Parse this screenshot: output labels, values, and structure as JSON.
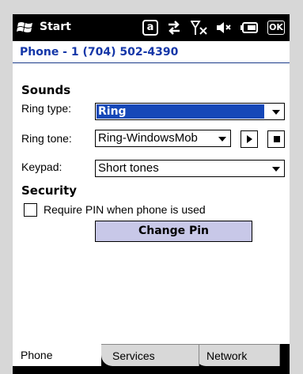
{
  "titlebar": {
    "start_label": "Start",
    "tray_icons": [
      "at-sign-icon",
      "sync-icon",
      "signal-off-icon",
      "speaker-muted-icon",
      "battery-icon"
    ],
    "at_glyph": "a",
    "ok_label": "OK"
  },
  "header": {
    "title": "Phone - 1 (704) 502-4390"
  },
  "sounds": {
    "section_label": "Sounds",
    "ring_type_label": "Ring type:",
    "ring_type_value": "Ring",
    "ring_tone_label": "Ring tone:",
    "ring_tone_value": "Ring-WindowsMob",
    "keypad_label": "Keypad:",
    "keypad_value": "Short tones"
  },
  "security": {
    "section_label": "Security",
    "require_pin_label": "Require PIN when phone is used",
    "require_pin_checked": false,
    "change_pin_label": "Change Pin"
  },
  "tabs": [
    {
      "label": "Phone",
      "active": true
    },
    {
      "label": "Services",
      "active": false
    },
    {
      "label": "Network",
      "active": false
    }
  ],
  "colors": {
    "header_text": "#1537a8",
    "selection": "#1648b8",
    "button_face": "#c8c8e8",
    "background": "#d7d7d7"
  }
}
